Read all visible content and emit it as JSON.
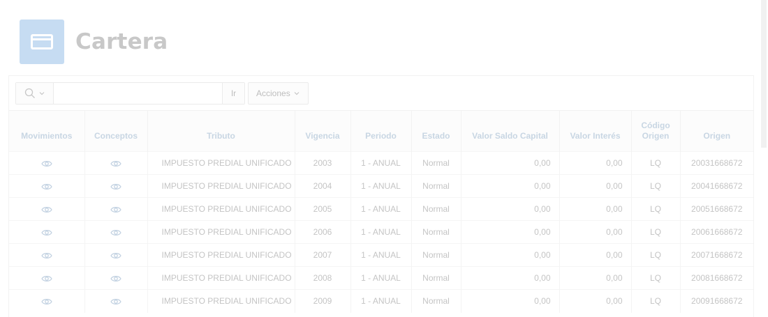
{
  "page": {
    "title": "Cartera",
    "icon": "credit-card-icon"
  },
  "toolbar": {
    "search_icon": "search-icon",
    "search_placeholder": "",
    "go_label": "Ir",
    "actions_label": "Acciones"
  },
  "table": {
    "columns": [
      "Movimientos",
      "Conceptos",
      "Tributo",
      "Vigencia",
      "Periodo",
      "Estado",
      "Valor Saldo Capital",
      "Valor Interés",
      "Código Origen",
      "Origen"
    ],
    "rows": [
      {
        "tributo": "IMPUESTO PREDIAL UNIFICADO",
        "vigencia": "2003",
        "periodo": "1 - ANUAL",
        "estado": "Normal",
        "capital": "0,00",
        "interes": "0,00",
        "codigo": "LQ",
        "origen": "20031668672"
      },
      {
        "tributo": "IMPUESTO PREDIAL UNIFICADO",
        "vigencia": "2004",
        "periodo": "1 - ANUAL",
        "estado": "Normal",
        "capital": "0,00",
        "interes": "0,00",
        "codigo": "LQ",
        "origen": "20041668672"
      },
      {
        "tributo": "IMPUESTO PREDIAL UNIFICADO",
        "vigencia": "2005",
        "periodo": "1 - ANUAL",
        "estado": "Normal",
        "capital": "0,00",
        "interes": "0,00",
        "codigo": "LQ",
        "origen": "20051668672"
      },
      {
        "tributo": "IMPUESTO PREDIAL UNIFICADO",
        "vigencia": "2006",
        "periodo": "1 - ANUAL",
        "estado": "Normal",
        "capital": "0,00",
        "interes": "0,00",
        "codigo": "LQ",
        "origen": "20061668672"
      },
      {
        "tributo": "IMPUESTO PREDIAL UNIFICADO",
        "vigencia": "2007",
        "periodo": "1 - ANUAL",
        "estado": "Normal",
        "capital": "0,00",
        "interes": "0,00",
        "codigo": "LQ",
        "origen": "20071668672"
      },
      {
        "tributo": "IMPUESTO PREDIAL UNIFICADO",
        "vigencia": "2008",
        "periodo": "1 - ANUAL",
        "estado": "Normal",
        "capital": "0,00",
        "interes": "0,00",
        "codigo": "LQ",
        "origen": "20081668672"
      },
      {
        "tributo": "IMPUESTO PREDIAL UNIFICADO",
        "vigencia": "2009",
        "periodo": "1 - ANUAL",
        "estado": "Normal",
        "capital": "0,00",
        "interes": "0,00",
        "codigo": "LQ",
        "origen": "20091668672"
      }
    ]
  },
  "colors": {
    "accent": "#c6dcf2",
    "header_text": "#c8d6e3",
    "link_icon": "#bfcfe0"
  }
}
